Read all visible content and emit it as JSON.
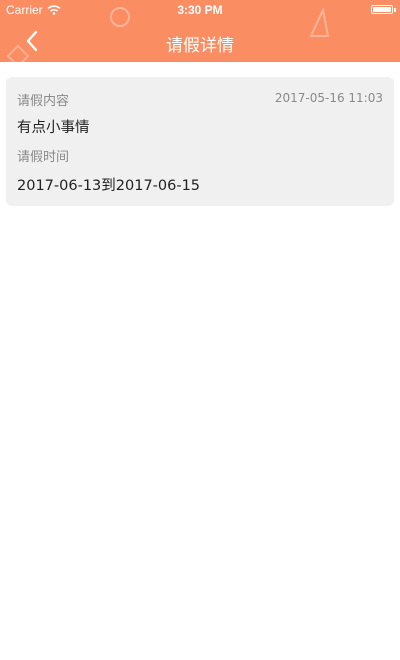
{
  "status_bar": {
    "carrier": "Carrier",
    "time": "3:30 PM"
  },
  "nav": {
    "title": "请假详情",
    "back_icon": "chevron-left-icon"
  },
  "colors": {
    "header_bg": "#fb8d62",
    "card_bg": "#f0f0f0",
    "label": "#8a8a8a",
    "value": "#222222"
  },
  "detail": {
    "content_label": "请假内容",
    "created_time": "2017-05-16 11:03",
    "content_value": "有点小事情",
    "time_label": "请假时间",
    "time_value": "2017-06-13到2017-06-15"
  }
}
